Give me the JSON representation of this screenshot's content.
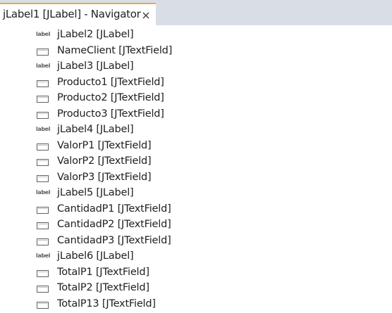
{
  "tab": {
    "title": "jLabel1 [JLabel] - Navigator",
    "close_icon": "close-icon"
  },
  "tree": {
    "items": [
      {
        "label": "jLabel2 [JLabel]",
        "icon": "label-icon",
        "icon_text": "label"
      },
      {
        "label": "NameClient [JTextField]",
        "icon": "textfield-icon"
      },
      {
        "label": "jLabel3 [JLabel]",
        "icon": "label-icon",
        "icon_text": "label"
      },
      {
        "label": "Producto1 [JTextField]",
        "icon": "textfield-icon"
      },
      {
        "label": "Producto2 [JTextField]",
        "icon": "textfield-icon"
      },
      {
        "label": "Producto3 [JTextField]",
        "icon": "textfield-icon"
      },
      {
        "label": "jLabel4 [JLabel]",
        "icon": "label-icon",
        "icon_text": "label"
      },
      {
        "label": "ValorP1 [JTextField]",
        "icon": "textfield-icon"
      },
      {
        "label": "ValorP2 [JTextField]",
        "icon": "textfield-icon"
      },
      {
        "label": "ValorP3 [JTextField]",
        "icon": "textfield-icon"
      },
      {
        "label": "jLabel5 [JLabel]",
        "icon": "label-icon",
        "icon_text": "label"
      },
      {
        "label": "CantidadP1 [JTextField]",
        "icon": "textfield-icon"
      },
      {
        "label": "CantidadP2 [JTextField]",
        "icon": "textfield-icon"
      },
      {
        "label": "CantidadP3 [JTextField]",
        "icon": "textfield-icon"
      },
      {
        "label": "jLabel6 [JLabel]",
        "icon": "label-icon",
        "icon_text": "label"
      },
      {
        "label": "TotalP1 [JTextField]",
        "icon": "textfield-icon"
      },
      {
        "label": "TotalP2 [JTextField]",
        "icon": "textfield-icon"
      },
      {
        "label": "TotalP13 [JTextField]",
        "icon": "textfield-icon"
      }
    ]
  },
  "colors": {
    "tabbar_bg": "#d9dee6",
    "tab_accent": "#f4a640",
    "text": "#202020",
    "icon": "#606060"
  }
}
